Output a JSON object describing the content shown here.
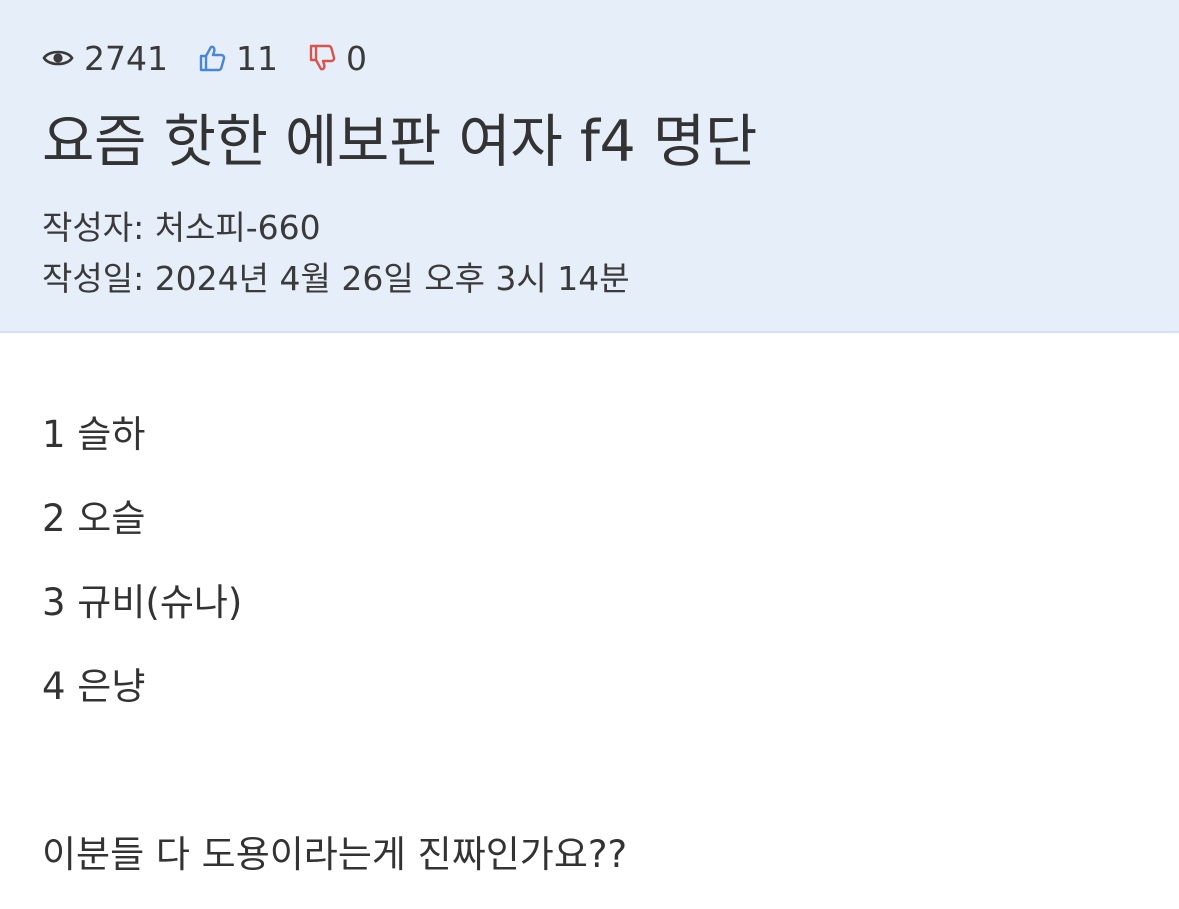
{
  "post": {
    "stats": {
      "views": "2741",
      "likes": "11",
      "dislikes": "0"
    },
    "title": "요즘 핫한 에보판 여자 f4 명단",
    "author_line": "작성자: 처소피-660",
    "date_line": "작성일: 2024년 4월 26일 오후 3시 14분",
    "body": {
      "list": [
        "1 슬하",
        "2 오슬",
        "3 규비(슈나)",
        "4 은냥"
      ],
      "question": "이분들 다 도용이라는게 진짜인가요??"
    }
  },
  "colors": {
    "header_bg": "#e6eef9",
    "like_icon": "#4a86d8",
    "dislike_icon": "#d9534f",
    "text": "#333333"
  },
  "icons": {
    "views": "eye-icon",
    "likes": "thumbs-up-icon",
    "dislikes": "thumbs-down-icon"
  }
}
